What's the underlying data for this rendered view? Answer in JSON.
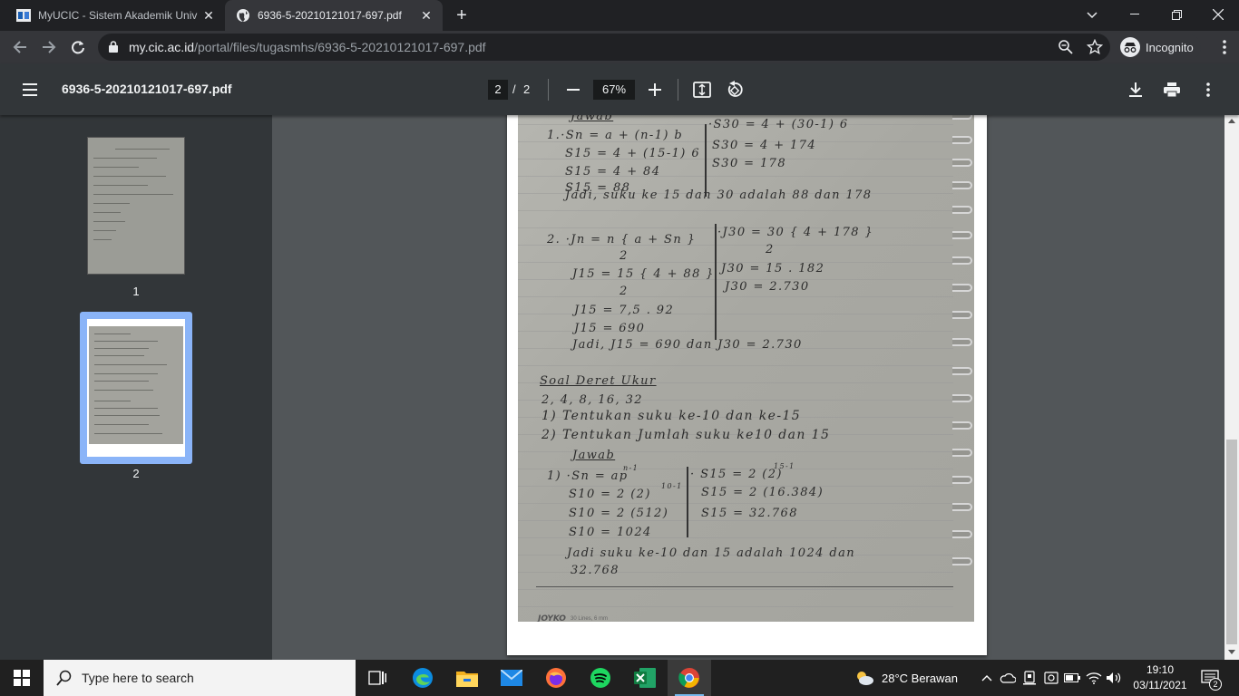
{
  "browser": {
    "tabs": [
      {
        "title": "MyUCIC - Sistem Akademik Univ",
        "close": "✕",
        "favicon": "ucic-logo-icon"
      },
      {
        "title": "6936-5-20210121017-697.pdf",
        "close": "✕",
        "favicon": "globe-icon"
      }
    ],
    "new_tab": "+",
    "url_host": "my.cic.ac.id",
    "url_path": "/portal/files/tugasmhs/6936-5-20210121017-697.pdf",
    "profile_label": "Incognito"
  },
  "pdf": {
    "title": "6936-5-20210121017-697.pdf",
    "current_page": "2",
    "page_separator": "/",
    "total_pages": "2",
    "zoom": "67%",
    "thumbnails": [
      {
        "label": "1"
      },
      {
        "label": "2"
      }
    ],
    "selected_thumbnail": "2"
  },
  "handwriting": {
    "jawab1": "Jawab",
    "a1l1": "1.·Sn  =  a + (n-1) b",
    "a1l2": "S15  =  4 + (15-1) 6",
    "a1l3": "S15  =  4 + 84",
    "a1l4": "S15  =  88",
    "a1r1": "·S30 = 4 + (30-1) 6",
    "a1r2": "S30 = 4 + 174",
    "a1r3": "S30  = 178",
    "a1c": "Jadi, suku ke 15 dan 30 adalah 88 dan 178",
    "a2l1": "2. ·Jn  =  n   { a + Sn }",
    "a2l1b": "2",
    "a2l2": "J15  =  15   { 4 + 88 }",
    "a2l2b": "2",
    "a2l3": "J15  =  7,5 . 92",
    "a2l4": "J15   =  690",
    "a2r1": "·J30 = 30   { 4 + 178 }",
    "a2r1b": "2",
    "a2r2": "J30  =  15 . 182",
    "a2r3": "J30  =  2.730",
    "a2c": "Jadi, J15 = 690 dan J30 = 2.730",
    "s2head": "Soal Deret Ukur",
    "s2seq": "2, 4, 8, 16, 32",
    "s2q1": "1) Tentukan suku ke-10 dan ke-15",
    "s2q2": "2) Tentukan Jumlah suku ke10 dan 15",
    "jawab2": "Jawab",
    "b1l1": "1) ·Sn = ap",
    "b1l1sup": "n-1",
    "b1l2": "S10  =  2 (2)",
    "b1l2sup": "10-1",
    "b1l3": "S10  =  2 (512)",
    "b1l4": "S10  =  1024",
    "b1r1": "· S15 = 2 (2)",
    "b1r1sup": "15-1",
    "b1r2": "S15 = 2 (16.384)",
    "b1r3": "S15  =  32.768",
    "b1c1": "Jadi suku ke-10 dan 15 adalah  1024  dan",
    "b1c2": "32.768"
  },
  "notebook": {
    "brand": "JOYKO",
    "sub": "30 Lines, 6 mm"
  },
  "taskbar": {
    "search_placeholder": "Type here to search",
    "weather": "28°C  Berawan",
    "time": "19:10",
    "date": "03/11/2021",
    "notifications": "2"
  }
}
